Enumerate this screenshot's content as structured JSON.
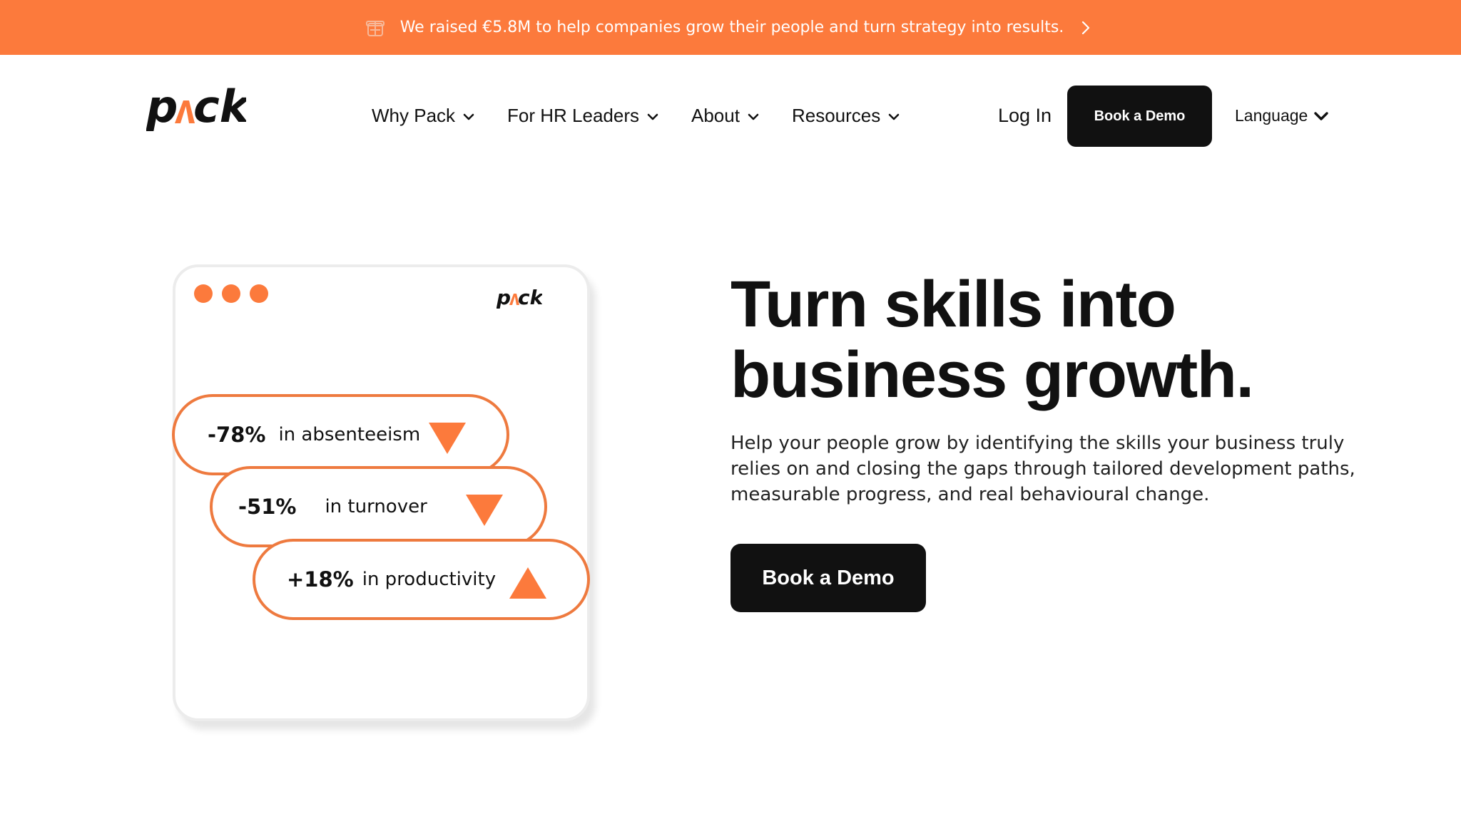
{
  "announcement": {
    "text": "We raised €5.8M to help companies grow their people and turn strategy into results.",
    "icon": "gift-icon",
    "chevron_icon": "chevron-right-icon"
  },
  "header": {
    "logo": "pack",
    "nav": [
      {
        "label": "Why Pack"
      },
      {
        "label": "For HR Leaders"
      },
      {
        "label": "About"
      },
      {
        "label": "Resources"
      }
    ],
    "login_label": "Log In",
    "cta_label": "Book a Demo",
    "language_label": "Language"
  },
  "illustration": {
    "logo": "pack",
    "stats": [
      {
        "value": "-78%",
        "label": "in absenteeism",
        "trend": "down"
      },
      {
        "value": "-51%",
        "label": "in turnover",
        "trend": "down"
      },
      {
        "value": "+18%",
        "label": "in productivity",
        "trend": "up"
      }
    ]
  },
  "hero": {
    "title_line1": "Turn skills into",
    "title_line2": "business growth.",
    "subtitle": "Help your people grow by identifying the skills your business truly relies on and closing the gaps through tailored development paths, measurable progress, and real behavioural change.",
    "cta_label": "Book a Demo"
  },
  "colors": {
    "accent": "#FC7A3C",
    "pill_border": "#EE7A3F",
    "dark": "#111111"
  }
}
